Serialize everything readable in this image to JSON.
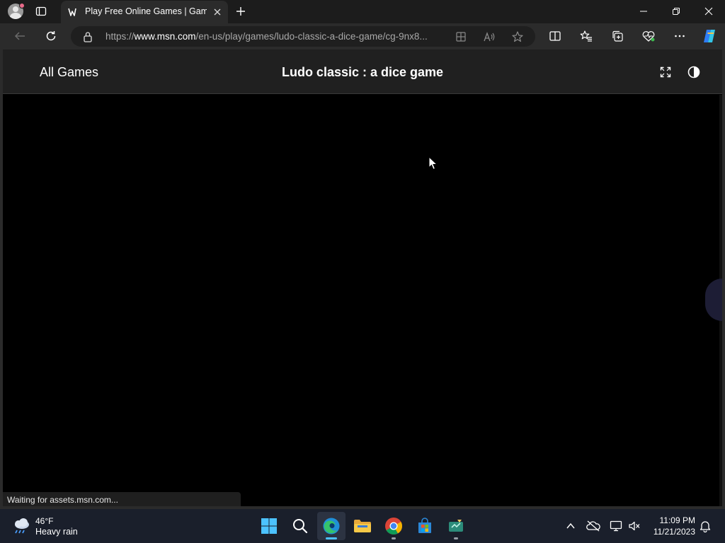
{
  "browser": {
    "tab": {
      "title": "Play Free Online Games | Games"
    },
    "address_bar": {
      "url_prefix": "https://",
      "url_domain": "www.msn.com",
      "url_path": "/en-us/play/games/ludo-classic-a-dice-game/cg-9nx8..."
    },
    "status_text": "Waiting for assets.msn.com..."
  },
  "page": {
    "all_games_label": "All Games",
    "game_title": "Ludo classic : a dice game"
  },
  "taskbar": {
    "weather": {
      "temperature": "46°F",
      "condition": "Heavy rain"
    },
    "apps": [
      "start",
      "search",
      "edge",
      "file-explorer",
      "chrome",
      "microsoft-store",
      "screen-tool"
    ],
    "active_app": "edge",
    "clock": {
      "time": "11:09 PM",
      "date": "11/21/2023"
    }
  },
  "colors": {
    "accent": "#4cc2ff",
    "tabbar": "#1c1c1c",
    "toolbar": "#2b2b2b",
    "taskbar": "#1a1f2b"
  }
}
